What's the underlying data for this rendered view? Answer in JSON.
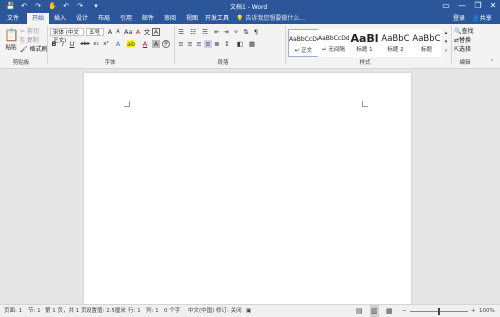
{
  "window": {
    "title": "文档1 - Word",
    "min": "—",
    "restore": "❐",
    "close": "✕"
  },
  "qat": {
    "save_icon": "💾",
    "undo_icon": "↶",
    "redo_icon": "↷"
  },
  "tabs": [
    {
      "label": "文件"
    },
    {
      "label": "开始"
    },
    {
      "label": "插入"
    },
    {
      "label": "设计"
    },
    {
      "label": "布局"
    },
    {
      "label": "引用"
    },
    {
      "label": "邮件"
    },
    {
      "label": "审阅"
    },
    {
      "label": "视图"
    },
    {
      "label": "开发工具"
    }
  ],
  "tell_me": "告诉我您想要做什么...",
  "account": {
    "login": "登录",
    "share": "共享"
  },
  "clipboard": {
    "paste": "粘贴",
    "cut": "剪切",
    "copy": "复制",
    "format_painter": "格式刷",
    "label": "剪贴板"
  },
  "font": {
    "name": "宋体 (中文正文)",
    "size": "五号",
    "label": "字体",
    "grow": "A",
    "shrink": "A",
    "clear": "A",
    "wen": "文",
    "bold": "B",
    "italic": "I",
    "underline": "U",
    "strike": "abc",
    "sub": "x₂",
    "sup": "x²",
    "color_a": "A"
  },
  "paragraph": {
    "label": "段落"
  },
  "styles": {
    "label": "样式",
    "items": [
      {
        "sample": "AaBbCcDd",
        "name": "正文"
      },
      {
        "sample": "AaBbCcDd",
        "name": "无间隔"
      },
      {
        "sample": "AaBl",
        "name": "标题 1"
      },
      {
        "sample": "AaBbC",
        "name": "标题 2"
      },
      {
        "sample": "AaBbC",
        "name": "标题"
      }
    ]
  },
  "editing": {
    "find": "查找",
    "replace": "替换",
    "select": "选择",
    "label": "编辑"
  },
  "status": {
    "page": "页面: 1",
    "section": "节: 1",
    "page_of": "第 1 页，共 1 页",
    "position": "设置值: 2.5厘米",
    "line": "行: 1",
    "col": "列: 1",
    "words": "0 个字",
    "lang": "中文(中国)",
    "track": "修订: 关闭",
    "zoom": "100%"
  }
}
